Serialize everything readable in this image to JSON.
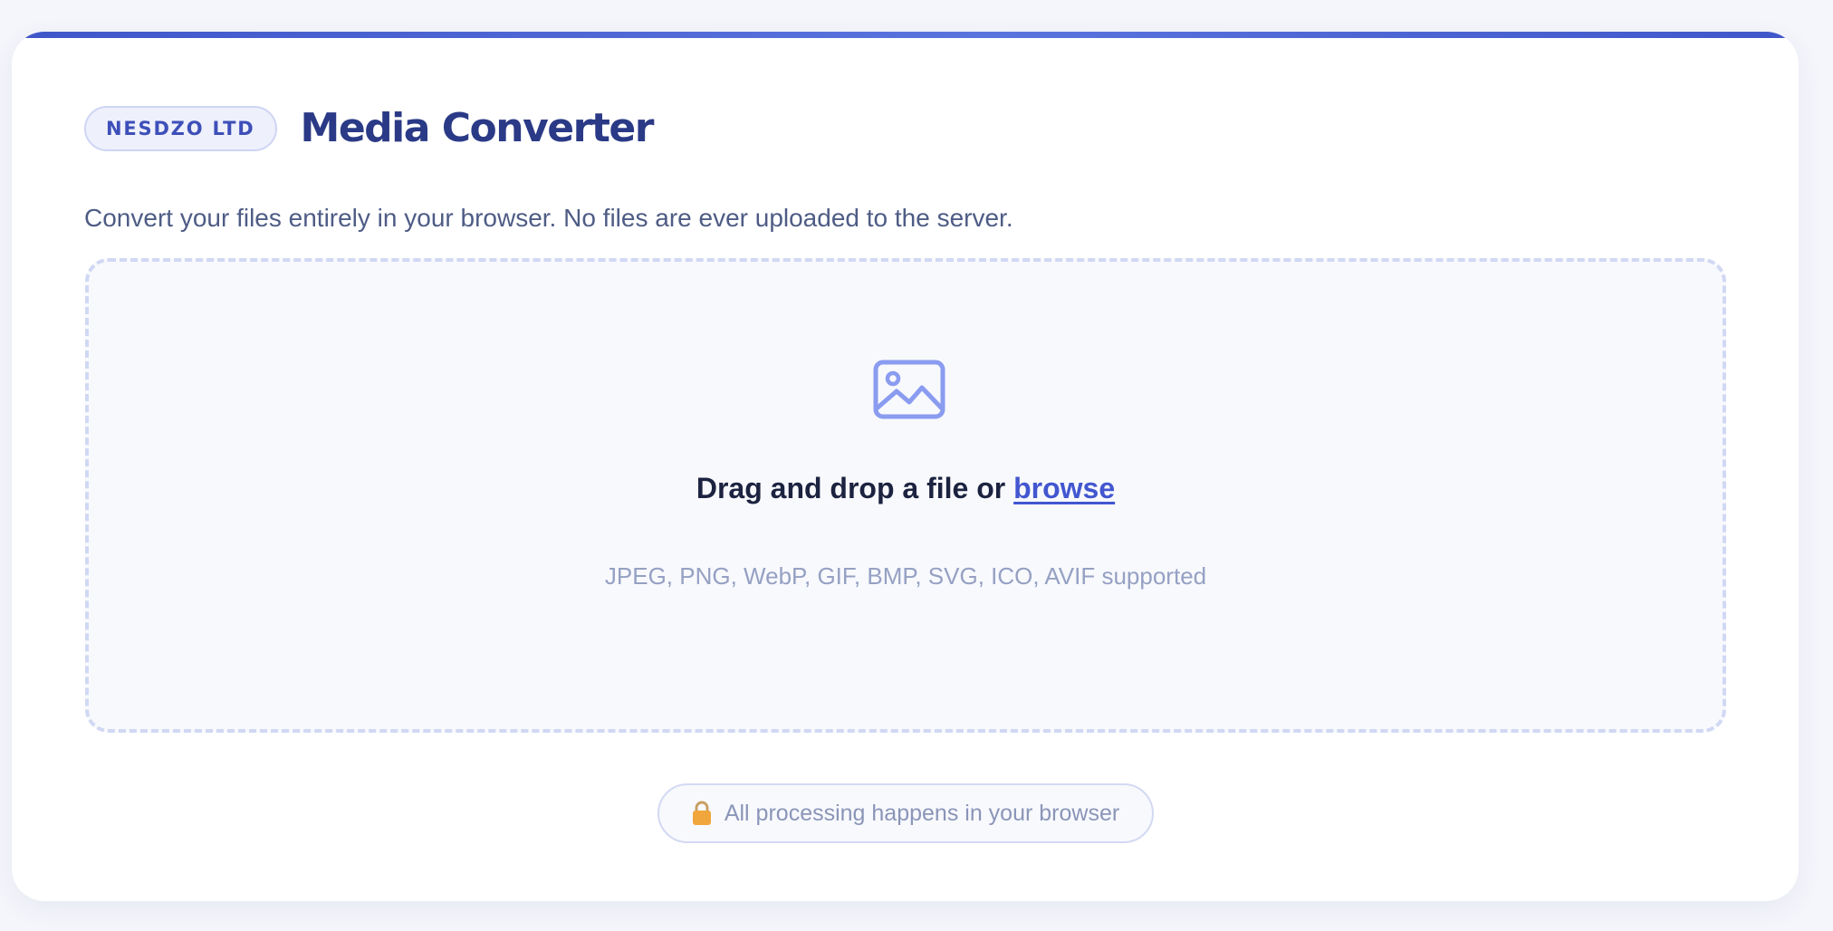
{
  "header": {
    "brand": "NESDZO LTD",
    "title": "Media Converter",
    "subtitle": "Convert your files entirely in your browser. No files are ever uploaded to the server."
  },
  "dropzone": {
    "icon": "image-icon",
    "prompt": "Drag and drop a file or ",
    "browse_label": "browse",
    "formats": "JPEG, PNG, WebP, GIF, BMP, SVG, ICO, AVIF supported"
  },
  "privacy": {
    "icon": "lock-icon",
    "text": "All processing happens in your browser"
  },
  "colors": {
    "accent": "#4256d0",
    "title": "#2b3a86",
    "lock": "#f0a63c"
  }
}
